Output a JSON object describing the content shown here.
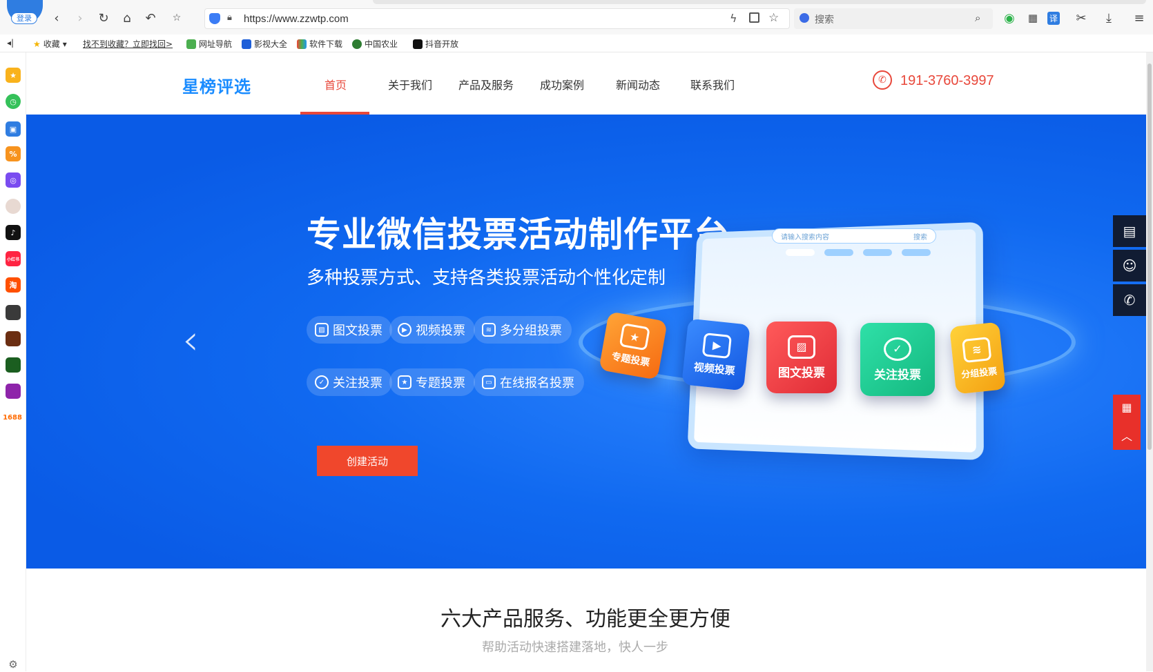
{
  "browser": {
    "login_badge": "登录",
    "url": "https://www.zzwtp.com",
    "search_placeholder": "搜索",
    "translate_label": "译"
  },
  "bookmarks": {
    "favorites": "收藏",
    "recover_link": "找不到收藏？立即找回>",
    "items": [
      "网址导航",
      "影视大全",
      "软件下载",
      "中国农业",
      "抖音开放"
    ]
  },
  "sidebar": {
    "items": [
      "star",
      "clock",
      "toolbox",
      "coupon",
      "game",
      "avatar",
      "douyin",
      "xiaohongshu",
      "taobao",
      "game-a",
      "game-b",
      "game-c",
      "game-d"
    ],
    "xiaohongshu_label": "小红书",
    "taobao_label": "淘",
    "ali_label": "1688"
  },
  "site": {
    "logo": "星榜评选",
    "nav": [
      "首页",
      "关于我们",
      "产品及服务",
      "成功案例",
      "新闻动态",
      "联系我们"
    ],
    "phone": "191-3760-3997",
    "colors": {
      "accent": "#e8483b",
      "banner": "#1069f0",
      "logo": "#1a8cff"
    }
  },
  "banner": {
    "title": "专业微信投票活动制作平台",
    "subtitle": "多种投票方式、支持各类投票活动个性化定制",
    "tags_row1": [
      "图文投票",
      "视频投票",
      "多分组投票"
    ],
    "tags_row2": [
      "关注投票",
      "专题投票",
      "在线报名投票"
    ],
    "create_button": "创建活动",
    "illustration": {
      "search_placeholder": "请输入搜索内容",
      "search_button": "搜索",
      "cards": [
        "专题投票",
        "视频投票",
        "图文投票",
        "关注投票",
        "分组投票"
      ]
    }
  },
  "section": {
    "title": "六大产品服务、功能更全更方便",
    "subtitle": "帮助活动快速搭建落地，快人一步"
  }
}
